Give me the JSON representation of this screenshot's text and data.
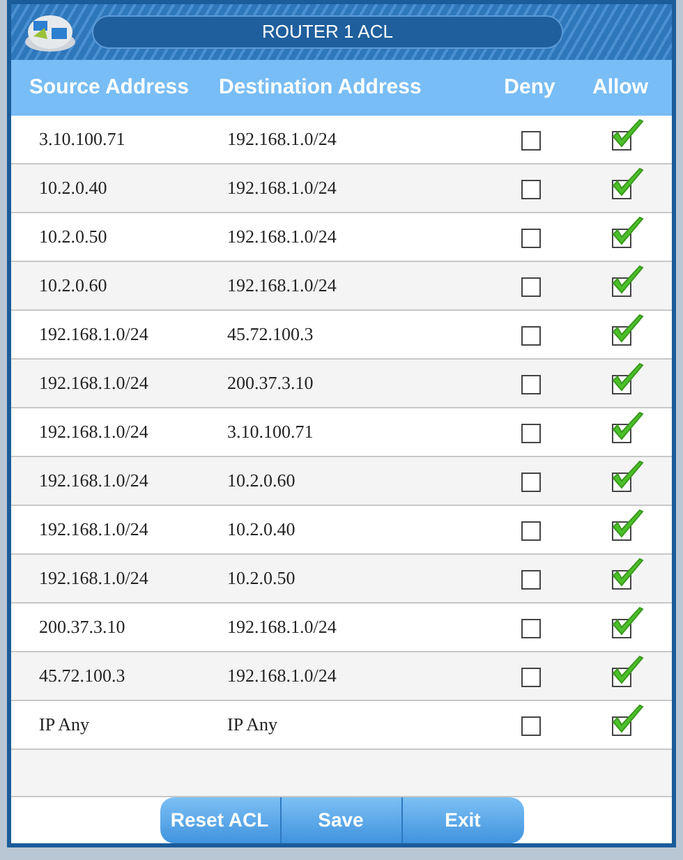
{
  "window": {
    "title": "ROUTER 1  ACL"
  },
  "table": {
    "columns": [
      "Source Address",
      "Destination Address",
      "Deny",
      "Allow"
    ],
    "rows": [
      {
        "source": "3.10.100.71",
        "destination": "192.168.1.0/24",
        "deny": false,
        "allow": true
      },
      {
        "source": "10.2.0.40",
        "destination": "192.168.1.0/24",
        "deny": false,
        "allow": true
      },
      {
        "source": "10.2.0.50",
        "destination": "192.168.1.0/24",
        "deny": false,
        "allow": true
      },
      {
        "source": "10.2.0.60",
        "destination": "192.168.1.0/24",
        "deny": false,
        "allow": true
      },
      {
        "source": "192.168.1.0/24",
        "destination": "45.72.100.3",
        "deny": false,
        "allow": true
      },
      {
        "source": "192.168.1.0/24",
        "destination": "200.37.3.10",
        "deny": false,
        "allow": true
      },
      {
        "source": "192.168.1.0/24",
        "destination": "3.10.100.71",
        "deny": false,
        "allow": true
      },
      {
        "source": "192.168.1.0/24",
        "destination": "10.2.0.60",
        "deny": false,
        "allow": true
      },
      {
        "source": "192.168.1.0/24",
        "destination": "10.2.0.40",
        "deny": false,
        "allow": true
      },
      {
        "source": "192.168.1.0/24",
        "destination": "10.2.0.50",
        "deny": false,
        "allow": true
      },
      {
        "source": "200.37.3.10",
        "destination": "192.168.1.0/24",
        "deny": false,
        "allow": true
      },
      {
        "source": "45.72.100.3",
        "destination": "192.168.1.0/24",
        "deny": false,
        "allow": true
      },
      {
        "source": "IP Any",
        "destination": "IP Any",
        "deny": false,
        "allow": true
      }
    ]
  },
  "buttons": [
    "Reset ACL",
    "Save",
    "Exit"
  ]
}
